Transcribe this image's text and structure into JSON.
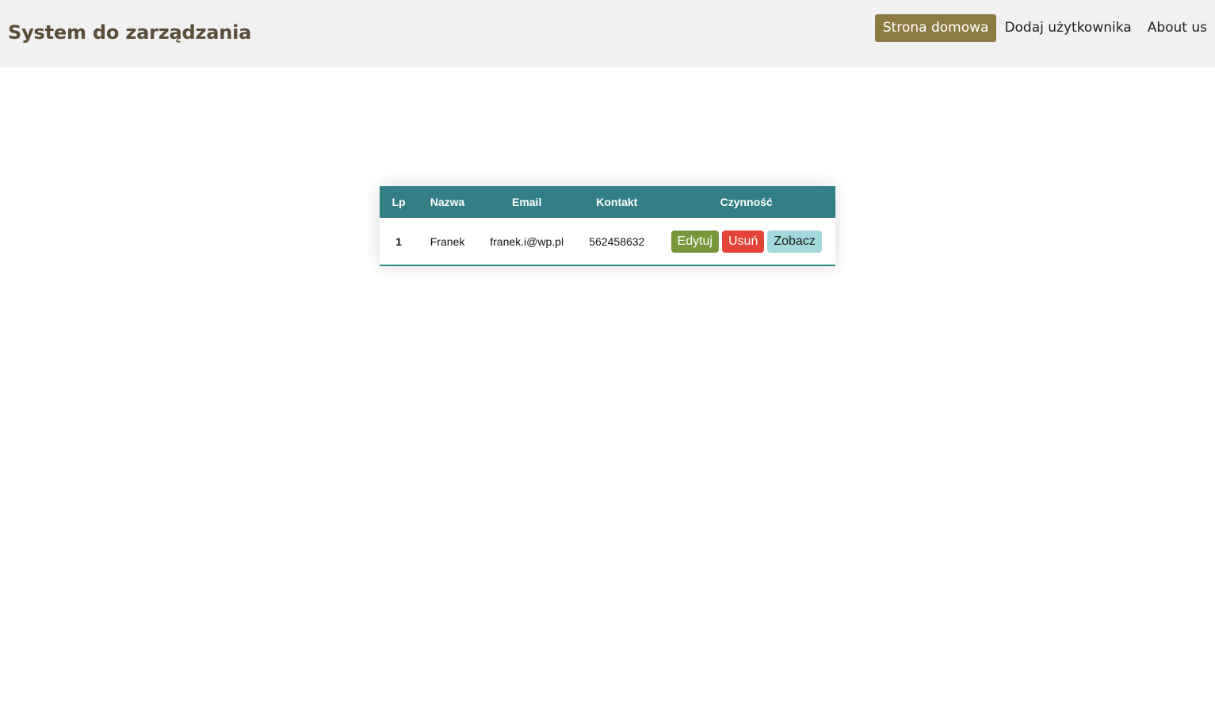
{
  "header": {
    "brand": "System do zarządzania",
    "nav": [
      {
        "label": "Strona domowa",
        "active": true
      },
      {
        "label": "Dodaj użytkownika",
        "active": false
      },
      {
        "label": "About us",
        "active": false
      }
    ]
  },
  "table": {
    "columns": [
      "Lp",
      "Nazwa",
      "Email",
      "Kontakt",
      "Czynność"
    ],
    "rows": [
      {
        "lp": "1",
        "name": "Franek",
        "email": "franek.i@wp.pl",
        "contact": "562458632",
        "actions": {
          "edit": "Edytuj",
          "delete": "Usuń",
          "view": "Zobacz"
        }
      }
    ]
  },
  "colors": {
    "header_bg": "#f1f1f1",
    "brand_text": "#5a4e3a",
    "nav_active_bg": "#8e7b43",
    "table_header_bg": "#337f86",
    "row_border": "#2a8a84",
    "edit_button": "#78973a",
    "delete_button": "#e5433a",
    "view_button": "#a3d9dc"
  }
}
